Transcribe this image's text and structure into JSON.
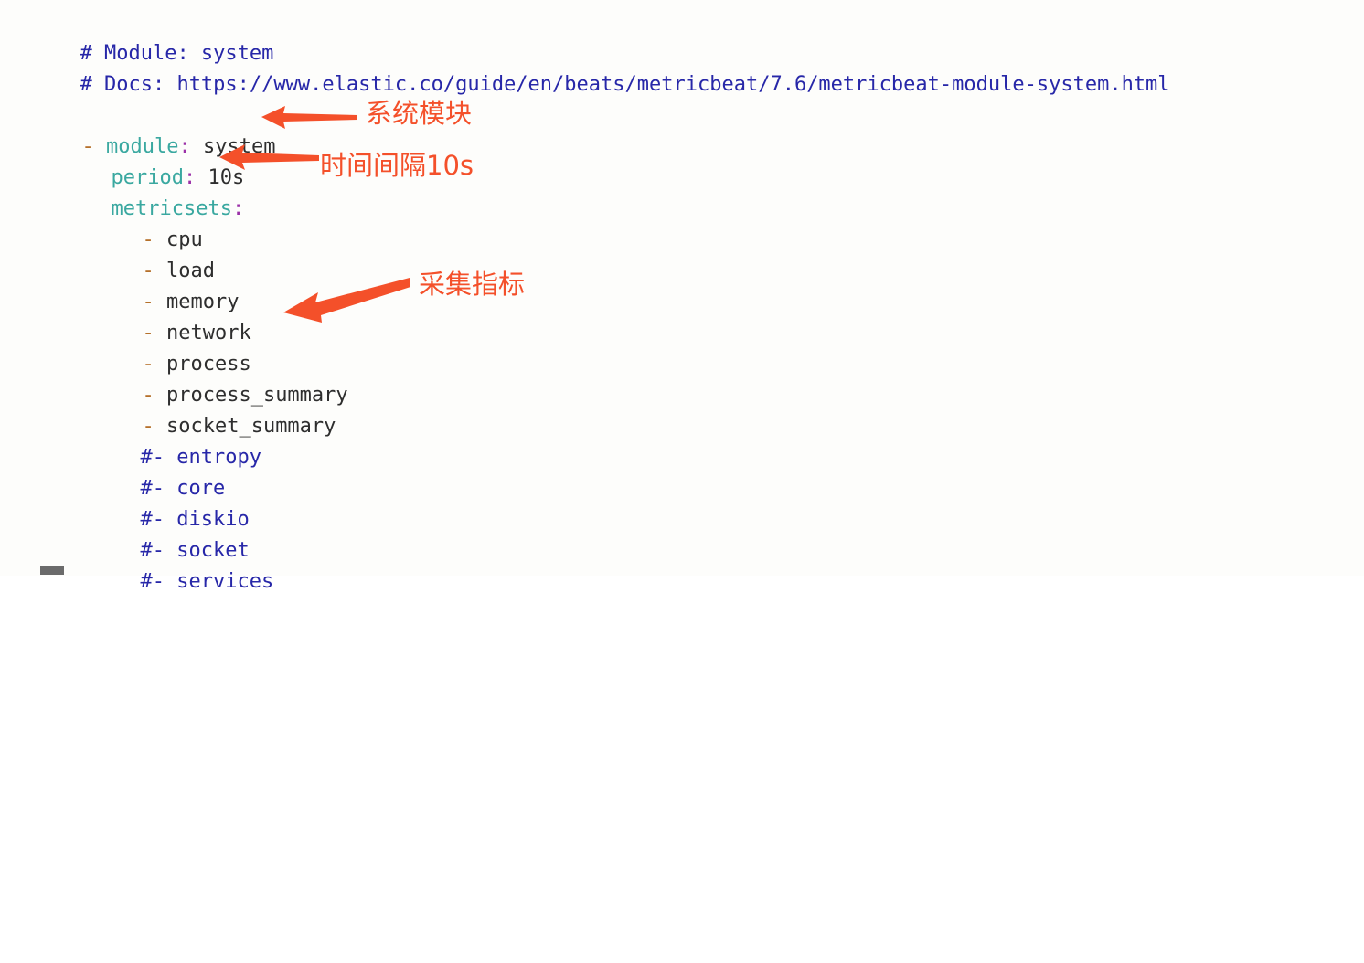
{
  "document": {
    "kind": "yaml-config",
    "background_color": "#fdfdfb",
    "comments": [
      {
        "text": "# Module: system"
      },
      {
        "text": "# Docs: https://www.elastic.co/guide/en/beats/metricbeat/7.6/metricbeat-module-system.html"
      }
    ],
    "entries": [
      {
        "dash": "-",
        "key": "module",
        "colon": ":",
        "value": "system"
      },
      {
        "dash": "",
        "key": "period",
        "colon": ":",
        "value": "10s"
      },
      {
        "dash": "",
        "key": "metricsets",
        "colon": ":",
        "value": ""
      }
    ],
    "metricsets_enabled": [
      {
        "dash": "-",
        "name": "cpu"
      },
      {
        "dash": "-",
        "name": "load"
      },
      {
        "dash": "-",
        "name": "memory"
      },
      {
        "dash": "-",
        "name": "network"
      },
      {
        "dash": "-",
        "name": "process"
      },
      {
        "dash": "-",
        "name": "process_summary"
      },
      {
        "dash": "-",
        "name": "socket_summary"
      }
    ],
    "metricsets_commented": [
      {
        "marker": "#-",
        "name": "entropy"
      },
      {
        "marker": "#-",
        "name": "core"
      },
      {
        "marker": "#-",
        "name": "diskio"
      },
      {
        "marker": "#-",
        "name": "socket"
      },
      {
        "marker": "#-",
        "name": "services"
      }
    ],
    "colors": {
      "comment": "#2727a8",
      "key": "#3aa8a0",
      "colon": "#9b30a8",
      "value": "#2e2e2e",
      "dash": "#b5702a",
      "annotation": "#f4502a"
    }
  },
  "annotations": [
    {
      "label": "系统模块",
      "arrow": "left-arrow-icon"
    },
    {
      "label": "时间间隔10s",
      "arrow": "left-arrow-icon"
    },
    {
      "label": "采集指标",
      "arrow": "left-arrow-icon"
    }
  ]
}
